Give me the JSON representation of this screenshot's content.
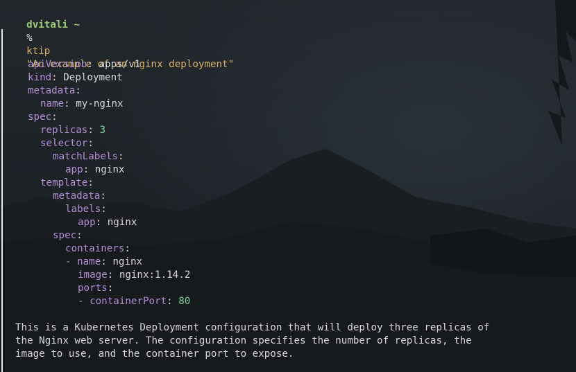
{
  "prompt": {
    "user_line": "dvitali ~",
    "symbol": "%",
    "command": "ktip",
    "argument": "\"An example of an nginx deployment\""
  },
  "yaml": {
    "apiVersion_key": "apiVersion",
    "apiVersion_val": "apps/v1",
    "kind_key": "kind",
    "kind_val": "Deployment",
    "metadata_key": "metadata",
    "name_key": "name",
    "name_val": "my-nginx",
    "spec_key": "spec",
    "replicas_key": "replicas",
    "replicas_val": "3",
    "selector_key": "selector",
    "matchLabels_key": "matchLabels",
    "app_key": "app",
    "app_val": "nginx",
    "template_key": "template",
    "metadata2_key": "metadata",
    "labels_key": "labels",
    "app2_key": "app",
    "app2_val": "nginx",
    "spec2_key": "spec",
    "containers_key": "containers",
    "dash1": "-",
    "cname_key": "name",
    "cname_val": "nginx",
    "image_key": "image",
    "image_val": "nginx:1.14.2",
    "ports_key": "ports",
    "dash2": "-",
    "containerPort_key": "containerPort",
    "containerPort_val": "80"
  },
  "description": [
    "This is a Kubernetes Deployment configuration that will deploy three replicas of",
    "the Nginx web server. The configuration specifies the number of replicas, the",
    "image to use, and the container port to expose."
  ],
  "colors": {
    "user": "#9cc87a",
    "command": "#d8b36a",
    "yaml_key": "#b38fd6",
    "yaml_number": "#7fd39a",
    "text": "#d8d8d8",
    "background": "#1d2126"
  }
}
